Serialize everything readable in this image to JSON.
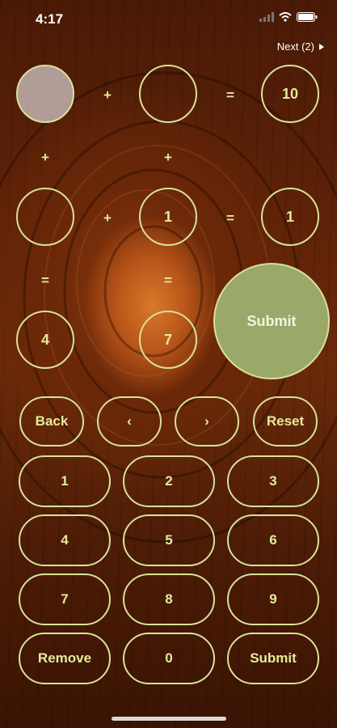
{
  "status": {
    "time": "4:17"
  },
  "header": {
    "next_label": "Next (2)"
  },
  "grid": {
    "row1": {
      "c1": "",
      "op1": "+",
      "c2": "",
      "eq": "=",
      "c3": "10"
    },
    "col_ops1": {
      "a": "+",
      "b": "+"
    },
    "row2": {
      "c1": "",
      "op1": "+",
      "c2": "1",
      "eq": "=",
      "c3": "1"
    },
    "col_ops2": {
      "a": "=",
      "b": "="
    },
    "row3": {
      "c1": "4",
      "c2": "7"
    }
  },
  "submit_big": "Submit",
  "controls": {
    "back": "Back",
    "prev": "‹",
    "next": "›",
    "reset": "Reset"
  },
  "keypad": {
    "k1": "1",
    "k2": "2",
    "k3": "3",
    "k4": "4",
    "k5": "5",
    "k6": "6",
    "k7": "7",
    "k8": "8",
    "k9": "9",
    "remove": "Remove",
    "k0": "0",
    "submit": "Submit"
  }
}
